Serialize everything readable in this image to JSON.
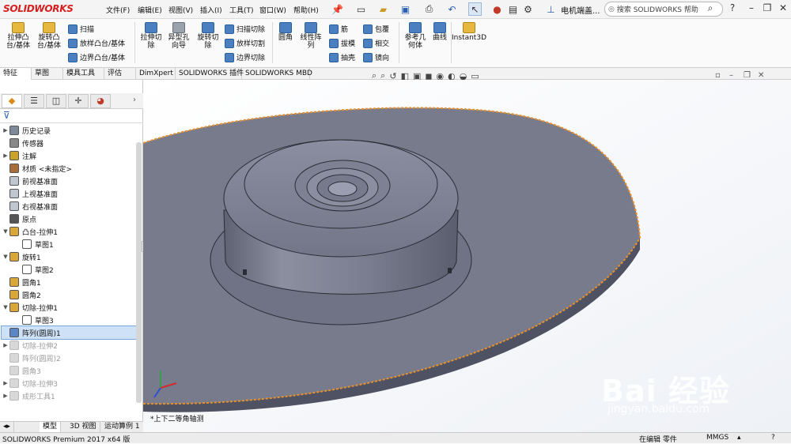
{
  "app": {
    "logo": "SOLIDWORKS",
    "doc_title": "电机端盖...",
    "help_search_placeholder": "搜索 SOLIDWORKS 帮助"
  },
  "menu": [
    "文件(F)",
    "编辑(E)",
    "视图(V)",
    "插入(I)",
    "工具(T)",
    "窗口(W)",
    "帮助(H)"
  ],
  "ribbon": {
    "extrude_boss": "拉伸凸\n台/基体",
    "revolve_boss": "旋转凸\n台/基体",
    "sweep": "扫描",
    "loft": "放样凸台/基体",
    "boundary": "边界凸台/基体",
    "extrude_cut": "拉伸切\n除",
    "hole_wizard": "异型孔\n向导",
    "revolve_cut": "旋转切\n除",
    "sweep_cut": "扫描切除",
    "loft_cut": "放样切割",
    "boundary_cut": "边界切除",
    "fillet": "圆角",
    "linear_pattern": "线性阵\n列",
    "rib": "筋",
    "draft": "拔模",
    "shell": "抽壳",
    "wrap": "包覆",
    "intersect": "相交",
    "mirror": "镜向",
    "ref_geometry": "参考几\n何体",
    "curves": "曲线",
    "instant3d": "Instant3D"
  },
  "tabs": [
    "特征",
    "草图",
    "模具工具",
    "评估",
    "DimXpert",
    "SOLIDWORKS 插件",
    "SOLIDWORKS MBD"
  ],
  "tree": [
    {
      "label": "历史记录",
      "exp": "▶",
      "icon": "history-icon",
      "dim": false,
      "sel": false,
      "indent": 0
    },
    {
      "label": "传感器",
      "exp": "",
      "icon": "sensor-icon",
      "dim": false,
      "sel": false,
      "indent": 0
    },
    {
      "label": "注解",
      "exp": "▶",
      "icon": "annotation-icon",
      "dim": false,
      "sel": false,
      "indent": 0
    },
    {
      "label": "材质 <未指定>",
      "exp": "",
      "icon": "material-icon",
      "dim": false,
      "sel": false,
      "indent": 0
    },
    {
      "label": "前视基准面",
      "exp": "",
      "icon": "plane-icon",
      "dim": false,
      "sel": false,
      "indent": 0
    },
    {
      "label": "上视基准面",
      "exp": "",
      "icon": "plane-icon",
      "dim": false,
      "sel": false,
      "indent": 0
    },
    {
      "label": "右视基准面",
      "exp": "",
      "icon": "plane-icon",
      "dim": false,
      "sel": false,
      "indent": 0
    },
    {
      "label": "原点",
      "exp": "",
      "icon": "origin-icon",
      "dim": false,
      "sel": false,
      "indent": 0
    },
    {
      "label": "凸台-拉伸1",
      "exp": "▼",
      "icon": "extrude-icon",
      "dim": false,
      "sel": false,
      "indent": 0
    },
    {
      "label": "草图1",
      "exp": "",
      "icon": "sketch-icon",
      "dim": false,
      "sel": false,
      "indent": 1
    },
    {
      "label": "旋转1",
      "exp": "▼",
      "icon": "revolve-icon",
      "dim": false,
      "sel": false,
      "indent": 0
    },
    {
      "label": "草图2",
      "exp": "",
      "icon": "sketch-icon",
      "dim": false,
      "sel": false,
      "indent": 1
    },
    {
      "label": "圆角1",
      "exp": "",
      "icon": "fillet-icon",
      "dim": false,
      "sel": false,
      "indent": 0
    },
    {
      "label": "圆角2",
      "exp": "",
      "icon": "fillet-icon",
      "dim": false,
      "sel": false,
      "indent": 0
    },
    {
      "label": "切除-拉伸1",
      "exp": "▼",
      "icon": "cut-extrude-icon",
      "dim": false,
      "sel": false,
      "indent": 0
    },
    {
      "label": "草图3",
      "exp": "",
      "icon": "sketch-icon",
      "dim": false,
      "sel": false,
      "indent": 1
    },
    {
      "label": "阵列(圆周)1",
      "exp": "",
      "icon": "circular-pattern-icon",
      "dim": false,
      "sel": true,
      "indent": 0
    },
    {
      "label": "切除-拉伸2",
      "exp": "▶",
      "icon": "cut-extrude-icon",
      "dim": true,
      "sel": false,
      "indent": 0
    },
    {
      "label": "阵列(圆周)2",
      "exp": "",
      "icon": "circular-pattern-icon",
      "dim": true,
      "sel": false,
      "indent": 0
    },
    {
      "label": "圆角3",
      "exp": "",
      "icon": "fillet-icon",
      "dim": true,
      "sel": false,
      "indent": 0
    },
    {
      "label": "切除-拉伸3",
      "exp": "▶",
      "icon": "cut-extrude-icon",
      "dim": true,
      "sel": false,
      "indent": 0
    },
    {
      "label": "成形工具1",
      "exp": "▶",
      "icon": "form-tool-icon",
      "dim": true,
      "sel": false,
      "indent": 0
    }
  ],
  "bottom_tabs": [
    "模型",
    "3D 视图",
    "运动算例 1"
  ],
  "view_label": "*上下二等角轴测",
  "status": {
    "version": "SOLIDWORKS Premium 2017 x64 版",
    "mode": "在编辑 零件",
    "units": "MMGS"
  },
  "watermark": {
    "brand": "Bai 经验",
    "url": "jingyan.baidu.com"
  },
  "colors": {
    "model": "#777b8c",
    "selection_edge": "#e8902a",
    "viewport_bg": "#ffffff",
    "accent": "#d81e1e"
  }
}
